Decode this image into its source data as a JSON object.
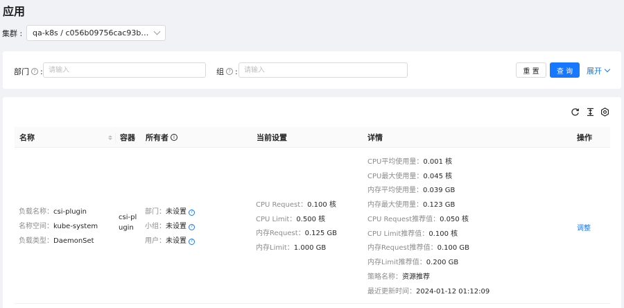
{
  "page": {
    "title": "应用"
  },
  "cluster": {
    "label": "集群 :",
    "value": "qa-k8s / c056b09756cac93b22f1ac2..."
  },
  "filters": {
    "department": {
      "label": "部门",
      "placeholder": "请输入",
      "value": ""
    },
    "group": {
      "label": "组",
      "placeholder": "请输入",
      "value": ""
    },
    "reset_label": "重 置",
    "query_label": "查 询",
    "expand_label": "展开"
  },
  "toolbar": {
    "icons": [
      "reload-icon",
      "column-height-icon",
      "setting-icon"
    ]
  },
  "table": {
    "columns": {
      "name": "名称",
      "container": "容器",
      "owner": "所有者",
      "current": "当前设置",
      "details": "详情",
      "action": "操作"
    },
    "rows": [
      {
        "name": {
          "workload_label": "负载名称：",
          "workload": "csi-plugin",
          "namespace_label": "名称空间：",
          "namespace": "kube-system",
          "type_label": "负载类型：",
          "type": "DaemonSet"
        },
        "container": "csi-plugin",
        "owner": {
          "department_label": "部门：",
          "department": "未设置",
          "group_label": "小组：",
          "group": "未设置",
          "user_label": "用户：",
          "user": "未设置"
        },
        "current": {
          "cpu_request_label": "CPU Request：",
          "cpu_request": "0.100 核",
          "cpu_limit_label": "CPU Limit：",
          "cpu_limit": "0.500 核",
          "mem_request_label": "内存Request：",
          "mem_request": "0.125 GB",
          "mem_limit_label": "内存Limit：",
          "mem_limit": "1.000 GB"
        },
        "details": [
          {
            "label": "CPU平均使用量：",
            "value": "0.001 核"
          },
          {
            "label": "CPU最大使用量：",
            "value": "0.045 核"
          },
          {
            "label": "内存平均使用量：",
            "value": "0.039 GB"
          },
          {
            "label": "内存最大使用量：",
            "value": "0.123 GB"
          },
          {
            "label": "CPU Request推荐值：",
            "value": "0.050 核"
          },
          {
            "label": "CPU Limit推荐值：",
            "value": "0.100 核"
          },
          {
            "label": "内存Request推荐值：",
            "value": "0.100 GB"
          },
          {
            "label": "内存Limit推荐值：",
            "value": "0.200 GB"
          },
          {
            "label": "策略名称：",
            "value": "资源推荐"
          },
          {
            "label": "最近更新时间：",
            "value": "2024-01-12 01:12:09"
          }
        ],
        "action": "调整"
      }
    ]
  }
}
